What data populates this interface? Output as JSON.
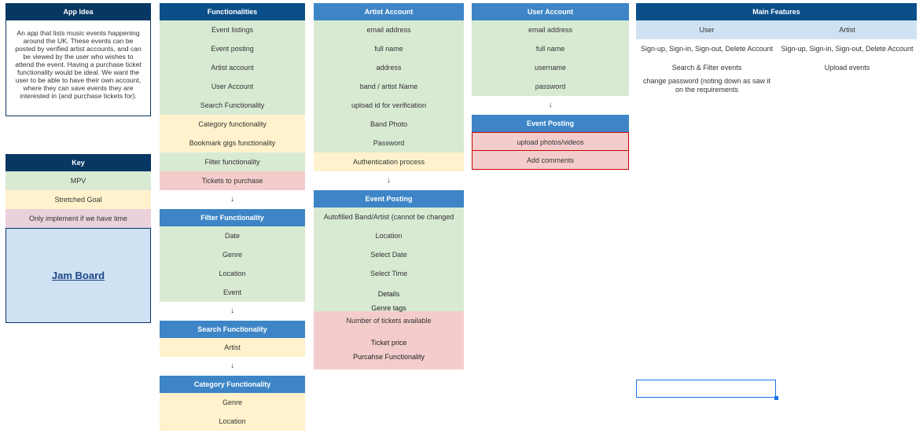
{
  "app_idea": {
    "header": "App Idea",
    "text": "An app that lists music events happening around the UK. These events can be posted by verified artist accounts, and can be viewed by the user who wishes to attend the event. Having a purchase ticket functionality would be ideal. We want the user to be able to have their own account, where they can save events they are interested in (and purchase tickets for)."
  },
  "key": {
    "header": "Key",
    "items": [
      "MPV",
      "Stretched Goal",
      "Only implement if we have time"
    ],
    "link": "Jam Board"
  },
  "functionalities": {
    "header": "Functionalities",
    "items": [
      "Event listings",
      "Event posting",
      "Artist account",
      "User Account",
      "Search Functionality",
      "Category functionality",
      "Bookmark gigs functionality",
      "Filter functionality",
      "Tickets to purchase"
    ]
  },
  "filter": {
    "header": "Filter Functionality",
    "items": [
      "Date",
      "Genre",
      "Location",
      "Event"
    ]
  },
  "search": {
    "header": "Search Functionality",
    "items": [
      "Artist"
    ]
  },
  "category": {
    "header": "Category Functionality",
    "items": [
      "Genre",
      "Location"
    ]
  },
  "artist_account": {
    "header": "Artist Account",
    "items": [
      "email address",
      "full name",
      "address",
      "band / artist Name",
      "upload id for verification",
      "Band Photo",
      "Password",
      "Authentication process"
    ]
  },
  "event_posting_artist": {
    "header": "Event Posting",
    "items": [
      "Autofilled Band/Artist  (cannot be changed",
      "Location",
      "Select Date",
      "Select Time",
      "Details",
      "Genre tags",
      "Number of tickets available",
      "Ticket price",
      "Purcahse Functionality"
    ]
  },
  "user_account": {
    "header": "User Account",
    "items": [
      "email address",
      "full name",
      "username",
      "password"
    ]
  },
  "event_posting_user": {
    "header": "Event Posting",
    "items": [
      "upload photos/videos",
      "Add comments"
    ]
  },
  "main_features": {
    "header": "Main Features",
    "user_header": "User",
    "artist_header": "Artist",
    "user_items": [
      "Sign-up, Sign-in, Sign-out, Delete Account",
      "Search & Filter events",
      "change password (noting down as saw it on the requirements"
    ],
    "artist_items": [
      "Sign-up, Sign-in, Sign-out, Delete Account",
      "Upload events"
    ]
  },
  "arrow": "↓",
  "colors": {
    "mvp": "#d9ead3",
    "stretched": "#fff2cc",
    "if_time": "#f4cccc",
    "header_dark": "#0b4f8a",
    "header_mid": "#3d85c6"
  }
}
